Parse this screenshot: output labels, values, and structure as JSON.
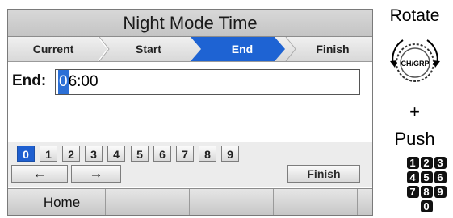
{
  "title": "Night Mode Time",
  "steps": [
    {
      "label": "Current"
    },
    {
      "label": "Start"
    },
    {
      "label": "End"
    },
    {
      "label": "Finish"
    }
  ],
  "active_step": "End",
  "field": {
    "label": "End:",
    "cursor_char": "0",
    "value_rest": "6:00"
  },
  "keypad": {
    "digits": [
      "0",
      "1",
      "2",
      "3",
      "4",
      "5",
      "6",
      "7",
      "8",
      "9"
    ],
    "selected_digit": "0",
    "left_label": "←",
    "right_label": "→",
    "finish_label": "Finish"
  },
  "softkeys": {
    "home_label": "Home"
  },
  "side": {
    "rotate_label": "Rotate",
    "knob_label": "CH/GRP",
    "plus_label": "+",
    "push_label": "Push",
    "numbers": [
      "1",
      "2",
      "3",
      "4",
      "5",
      "6",
      "7",
      "8",
      "9",
      "0"
    ]
  },
  "colors": {
    "accent": "#1e5fd0",
    "title_bg": "#cfcfcf"
  }
}
